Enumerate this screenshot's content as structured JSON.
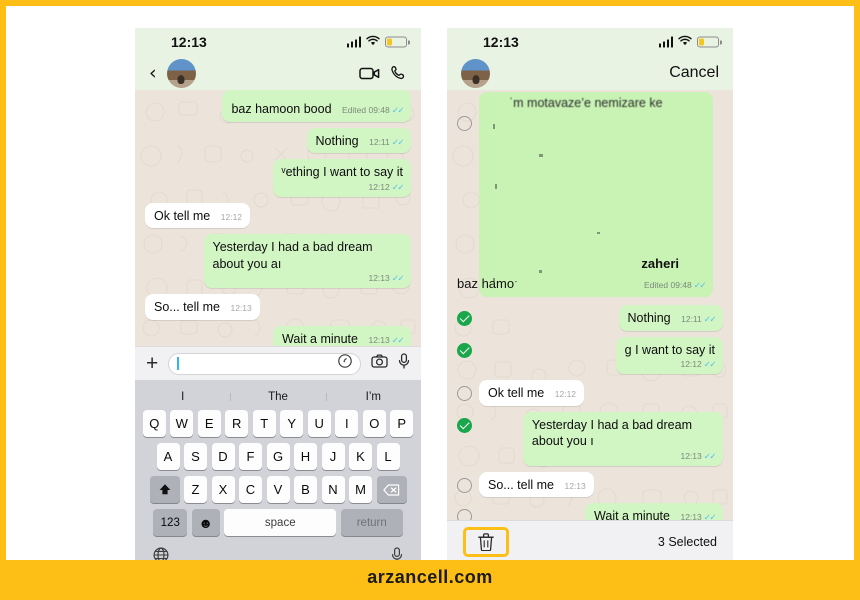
{
  "brand": {
    "text": "arzancell.com",
    "band_color": "#FDBE15"
  },
  "colors": {
    "accent": "#FDBE15",
    "outgoing_bubble": "#d2f5c4",
    "incoming_bubble": "#ffffff",
    "chat_background": "#ece4db",
    "header_background": "#e8f3e3",
    "selected_check": "#1aa64b",
    "tick_blue": "#53bdeb"
  },
  "phone_left": {
    "status_bar": {
      "time": "12:13",
      "signal_icon": "cellular-bars-icon",
      "wifi_icon": "wifi-icon",
      "battery_icon": "battery-low-icon"
    },
    "header": {
      "back_icon": "back-chevron-icon",
      "avatar": "contact-avatar",
      "video_icon": "video-call-icon",
      "call_icon": "phone-call-icon"
    },
    "messages": [
      {
        "id": "m0",
        "side": "out",
        "text": "baz hamoon bood",
        "redacted_above": true,
        "meta": "Edited 09:48",
        "ticks": true
      },
      {
        "id": "m1",
        "side": "out",
        "text": "Nothing",
        "meta": "12:11",
        "ticks": true
      },
      {
        "id": "m2",
        "side": "out",
        "text": "ᵛething I want to say it",
        "meta": "12:12",
        "ticks": true,
        "meta_below": true
      },
      {
        "id": "m3",
        "side": "in",
        "text": "Ok tell me",
        "meta": "12:12",
        "ticks": false
      },
      {
        "id": "m4",
        "side": "out",
        "text": "Yesterday I had a bad dream about you aı",
        "meta": "12:13",
        "ticks": true,
        "meta_below": true
      },
      {
        "id": "m5",
        "side": "in",
        "text": "So... tell me",
        "meta": "12:13",
        "ticks": false
      },
      {
        "id": "m6",
        "side": "out",
        "text": "Wait a minute",
        "meta": "12:13",
        "ticks": true
      }
    ],
    "input_bar": {
      "plus_icon": "attach-plus-icon",
      "placeholder": "",
      "value": "",
      "sticker_icon": "sticker-icon",
      "camera_icon": "camera-icon",
      "mic_icon": "microphone-icon"
    },
    "keyboard": {
      "suggestions": [
        "I",
        "The",
        "I’m"
      ],
      "row1": [
        "Q",
        "W",
        "E",
        "R",
        "T",
        "Y",
        "U",
        "I",
        "O",
        "P"
      ],
      "row2": [
        "A",
        "S",
        "D",
        "F",
        "G",
        "H",
        "J",
        "K",
        "L"
      ],
      "row3": [
        "Z",
        "X",
        "C",
        "V",
        "B",
        "N",
        "M"
      ],
      "shift_icon": "shift-arrow-icon",
      "backspace_icon": "backspace-icon",
      "numbers_key": "123",
      "emoji_icon": "emoji-smiley-icon",
      "space_key": "space",
      "return_key": "return",
      "globe_icon": "globe-language-icon",
      "dictation_icon": "microphone-icon"
    }
  },
  "phone_right": {
    "status_bar": {
      "time": "12:13",
      "signal_icon": "cellular-bars-icon",
      "wifi_icon": "wifi-icon",
      "battery_icon": "battery-low-icon"
    },
    "header": {
      "avatar": "contact-avatar",
      "cancel_label": "Cancel"
    },
    "big_message": {
      "top_text": "ˈm motavaze’e nemizare ke",
      "name_text": "zaheri",
      "left_text": "baz hamoˑ",
      "meta": "Edited 09:48",
      "ticks": true,
      "selected": false
    },
    "messages": [
      {
        "id": "r1",
        "side": "out",
        "text": "Nothing",
        "meta": "12:11",
        "ticks": true,
        "selected": true
      },
      {
        "id": "r2",
        "side": "out",
        "text": "g I want to say it",
        "meta": "12:12",
        "ticks": true,
        "selected": true,
        "meta_below": true
      },
      {
        "id": "r3",
        "side": "in",
        "text": "Ok tell me",
        "meta": "12:12",
        "ticks": false,
        "selected": false
      },
      {
        "id": "r4",
        "side": "out",
        "text": "Yesterday I had a bad dream about you ı",
        "meta": "12:13",
        "ticks": true,
        "selected": true,
        "meta_below": true
      },
      {
        "id": "r5",
        "side": "in",
        "text": "So... tell me",
        "meta": "12:13",
        "ticks": false,
        "selected": false
      },
      {
        "id": "r6",
        "side": "out",
        "text": "Wait a minute",
        "meta": "12:13",
        "ticks": true,
        "selected": false
      }
    ],
    "action_bar": {
      "delete_icon": "trash-delete-icon",
      "selected_label": "3 Selected",
      "delete_highlighted": true
    }
  }
}
